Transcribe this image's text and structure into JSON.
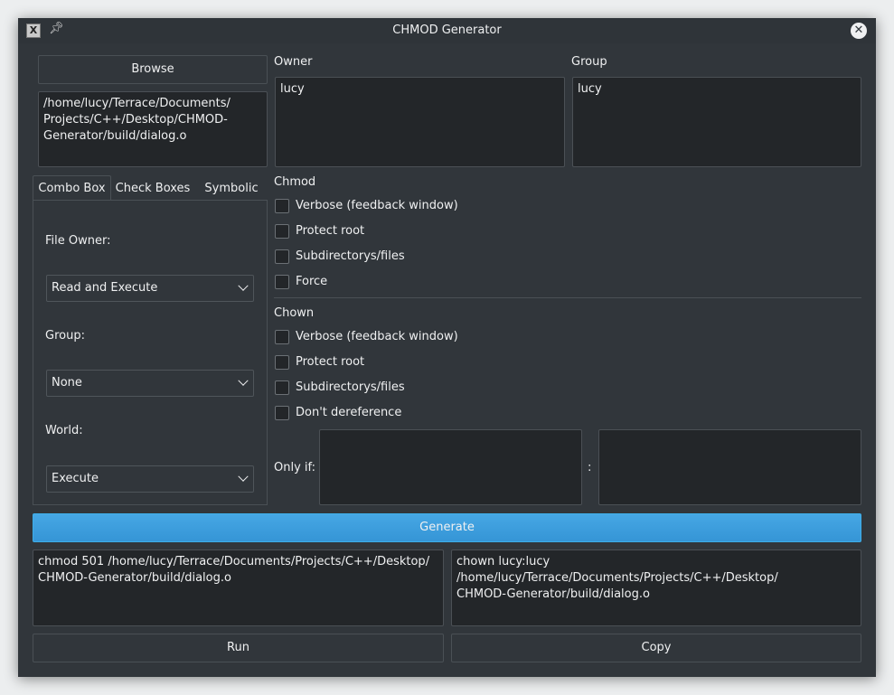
{
  "window": {
    "title": "CHMOD Generator",
    "app_icon": "app-icon",
    "pin_icon": "pin-icon",
    "close_icon": "close-icon"
  },
  "browse": {
    "label": "Browse",
    "path": "/home/lucy/Terrace/Documents/\nProjects/C++/Desktop/CHMOD-\nGenerator/build/dialog.o"
  },
  "owner": {
    "label": "Owner",
    "value": "lucy"
  },
  "group": {
    "label": "Group",
    "value": "lucy"
  },
  "tabs": [
    {
      "label": "Combo Box",
      "active": true
    },
    {
      "label": "Check Boxes",
      "active": false
    },
    {
      "label": "Symbolic",
      "active": false
    }
  ],
  "combo": {
    "file_owner_label": "File Owner:",
    "file_owner_value": "Read and Execute",
    "group_label": "Group:",
    "group_value": "None",
    "world_label": "World:",
    "world_value": "Execute"
  },
  "chmod": {
    "heading": "Chmod",
    "options": [
      {
        "label": "Verbose (feedback window)",
        "checked": false
      },
      {
        "label": "Protect root",
        "checked": false
      },
      {
        "label": "Subdirectorys/files",
        "checked": false
      },
      {
        "label": "Force",
        "checked": false
      }
    ]
  },
  "chown": {
    "heading": "Chown",
    "options": [
      {
        "label": "Verbose (feedback window)",
        "checked": false
      },
      {
        "label": "Protect root",
        "checked": false
      },
      {
        "label": "Subdirectorys/files",
        "checked": false
      },
      {
        "label": "Don't dereference",
        "checked": false
      }
    ],
    "only_if_label": "Only if:",
    "separator": ":",
    "only_if_owner": "",
    "only_if_group": ""
  },
  "generate_label": "Generate",
  "output": {
    "chmod_command": "chmod 501 /home/lucy/Terrace/Documents/Projects/C++/Desktop/\nCHMOD-Generator/build/dialog.o",
    "chown_command": "chown lucy:lucy /home/lucy/Terrace/Documents/Projects/C++/Desktop/\nCHMOD-Generator/build/dialog.o"
  },
  "run_label": "Run",
  "copy_label": "Copy",
  "colors": {
    "window_bg": "#31363b",
    "field_bg": "#232629",
    "accent": "#3daee9"
  }
}
